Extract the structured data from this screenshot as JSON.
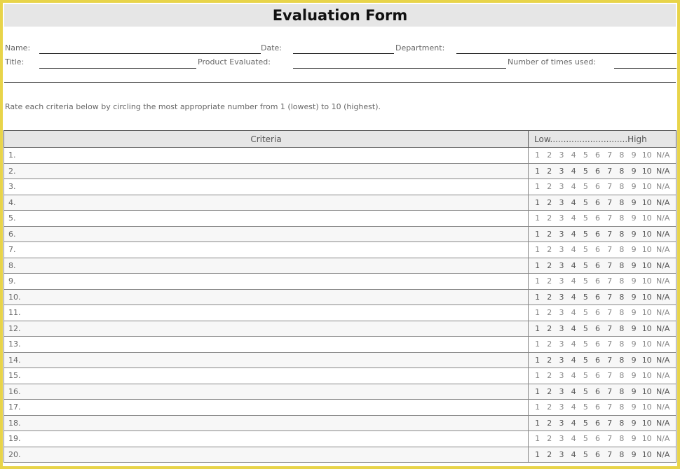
{
  "title": "Evaluation Form",
  "fields": {
    "name": "Name:",
    "date": "Date:",
    "department": "Department:",
    "title": "Title:",
    "product": "Product Evaluated:",
    "times_used": "Number of times used:"
  },
  "instructions": "Rate each criteria below by circling the most appropriate number from 1 (lowest) to 10 (highest).",
  "table": {
    "criteria_header": "Criteria",
    "scale_header": "Low.............................High",
    "rating_labels": [
      "1",
      "2",
      "3",
      "4",
      "5",
      "6",
      "7",
      "8",
      "9",
      "10",
      "N/A"
    ],
    "rows": [
      "1.",
      "2.",
      "3.",
      "4.",
      "5.",
      "6.",
      "7.",
      "8.",
      "9.",
      "10.",
      "11.",
      "12.",
      "13.",
      "14.",
      "15.",
      "16.",
      "17.",
      "18.",
      "19.",
      "20."
    ]
  }
}
